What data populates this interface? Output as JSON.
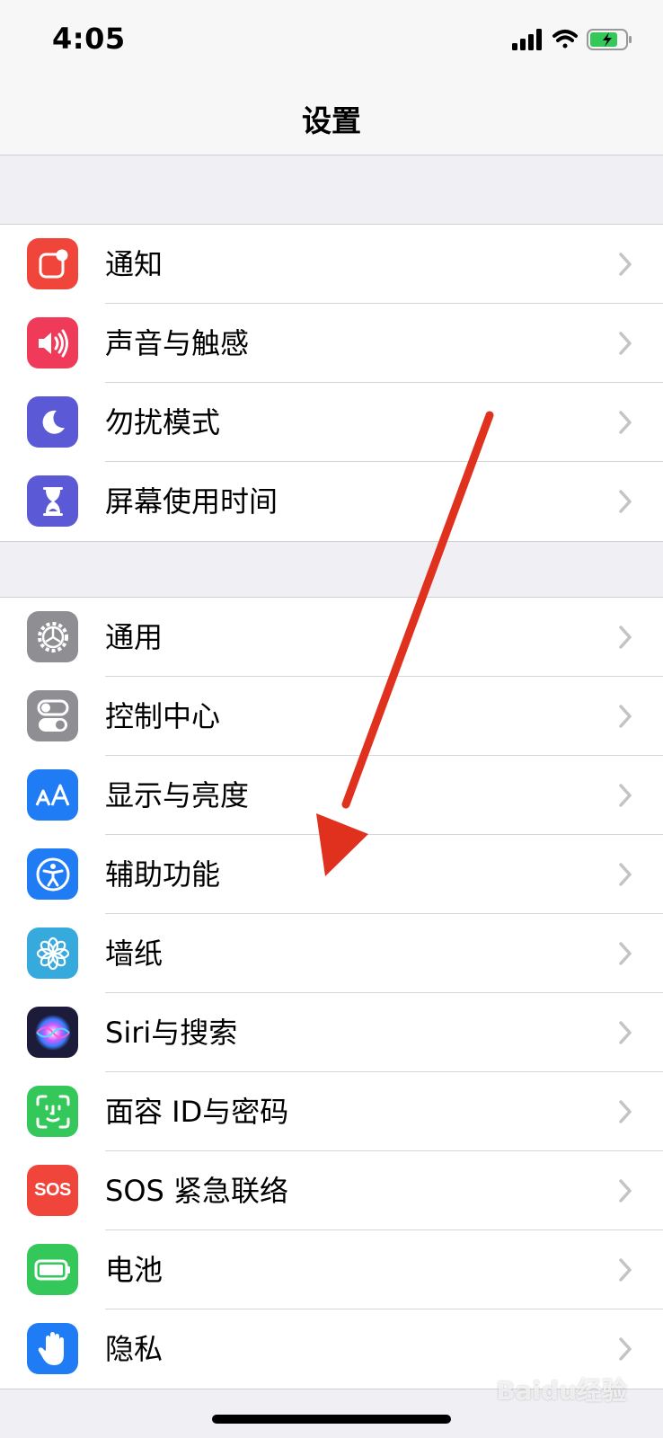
{
  "status_bar": {
    "time": "4:05"
  },
  "nav": {
    "title": "设置"
  },
  "groups": [
    {
      "items": [
        {
          "label": "通知",
          "icon": "notifications-icon",
          "color": "#f0453a"
        },
        {
          "label": "声音与触感",
          "icon": "sounds-icon",
          "color": "#f03a5a"
        },
        {
          "label": "勿扰模式",
          "icon": "moon-icon",
          "color": "#5b59d6"
        },
        {
          "label": "屏幕使用时间",
          "icon": "hourglass-icon",
          "color": "#5b59d6"
        }
      ]
    },
    {
      "items": [
        {
          "label": "通用",
          "icon": "gear-icon",
          "color": "#8e8e93"
        },
        {
          "label": "控制中心",
          "icon": "toggles-icon",
          "color": "#8e8e93"
        },
        {
          "label": "显示与亮度",
          "icon": "text-size-icon",
          "color": "#1f7cf5"
        },
        {
          "label": "辅助功能",
          "icon": "accessibility-icon",
          "color": "#1f7cf5"
        },
        {
          "label": "墙纸",
          "icon": "flower-icon",
          "color": "#36aadc"
        },
        {
          "label": "Siri与搜索",
          "icon": "siri-icon",
          "color": "#1c1c3a"
        },
        {
          "label": "面容 ID与密码",
          "icon": "face-id-icon",
          "color": "#34c759"
        },
        {
          "label": "SOS 紧急联络",
          "icon": "sos-icon",
          "color": "#f0453a",
          "icon_text": "SOS"
        },
        {
          "label": "电池",
          "icon": "battery-icon",
          "color": "#34c759"
        },
        {
          "label": "隐私",
          "icon": "hand-icon",
          "color": "#1f7cf5"
        }
      ]
    }
  ],
  "overlay": {
    "arrow_color": "#e0301e"
  },
  "watermark": "Baidu经验"
}
